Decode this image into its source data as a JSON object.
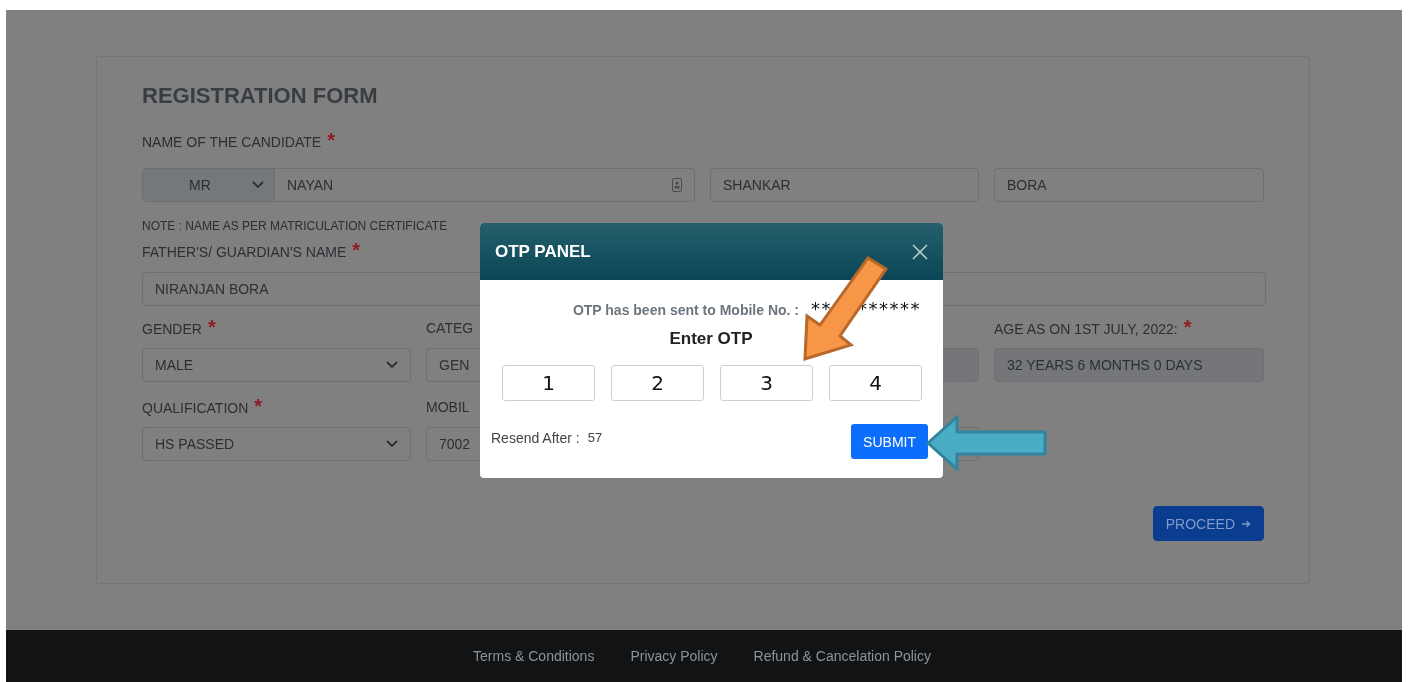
{
  "form": {
    "title": "REGISTRATION FORM",
    "name_label": {
      "text": "NAME OF THE CANDIDATE",
      "required_mark": "*"
    },
    "salutation": "MR",
    "first_name": "NAYAN",
    "middle_name": "SHANKAR",
    "last_name": "BORA",
    "note": "NOTE : NAME AS PER MATRICULATION CERTIFICATE",
    "father_label": {
      "text": "FATHER'S/ GUARDIAN'S NAME",
      "required_mark": "*"
    },
    "father_name": "NIRANJAN BORA",
    "rows": [
      [
        {
          "label": "GENDER",
          "required_mark": "*",
          "value": "MALE",
          "kind": "select"
        },
        {
          "label": "CATEG",
          "value": "GEN",
          "kind": "text"
        },
        {
          "kind": "readonly"
        },
        {
          "label": "AGE AS ON 1ST JULY, 2022:",
          "required_mark": "*",
          "value": "32 YEARS 6 MONTHS 0 DAYS",
          "kind": "readonly"
        }
      ],
      [
        {
          "label": "QUALIFICATION",
          "required_mark": "*",
          "value": "HS PASSED",
          "kind": "select"
        },
        {
          "label": "MOBIL",
          "value": "7002",
          "kind": "text"
        },
        {
          "kind": "text"
        }
      ]
    ],
    "proceed": "PROCEED"
  },
  "otp_panel": {
    "title": "OTP PANEL",
    "message": "OTP has been sent to Mobile No. :",
    "masked_number_parts": [
      "**",
      "******"
    ],
    "prompt": "Enter OTP",
    "digits": [
      "1",
      "2",
      "3",
      "4"
    ],
    "resend_label": "Resend After :",
    "countdown": "57",
    "submit": "SUBMIT"
  },
  "footer": {
    "links": [
      "Terms & Conditions",
      "Privacy Policy",
      "Refund & Cancelation Policy"
    ]
  }
}
